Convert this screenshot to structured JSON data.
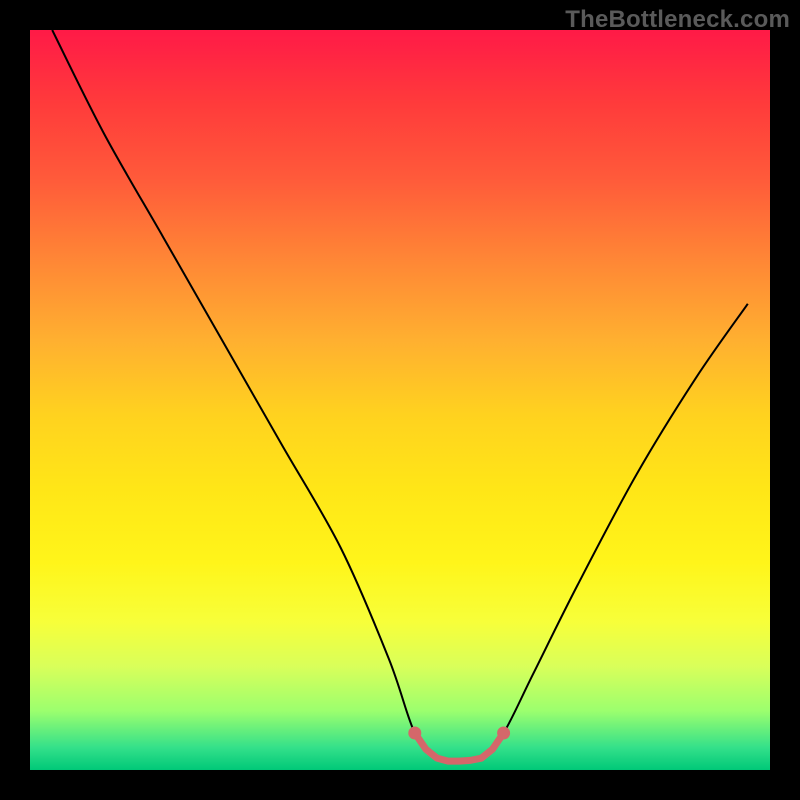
{
  "watermark": "TheBottleneck.com",
  "colors": {
    "frame": "#000000",
    "gradient_top": "#ff1a47",
    "gradient_bottom": "#00c878",
    "curve": "#000000",
    "marker_stroke": "#d4676a",
    "marker_fill": "#d4676a"
  },
  "chart_data": {
    "type": "line",
    "title": "",
    "xlabel": "",
    "ylabel": "",
    "xlim": [
      0,
      100
    ],
    "ylim": [
      0,
      100
    ],
    "series": [
      {
        "name": "curve",
        "x": [
          3,
          10,
          18,
          26,
          34,
          42,
          48.5,
          52,
          55,
          58,
          61,
          64,
          68,
          74,
          82,
          90,
          97
        ],
        "values": [
          100,
          86,
          72,
          58,
          44,
          30,
          15,
          5,
          1.5,
          1.2,
          1.5,
          5,
          13,
          25,
          40,
          53,
          63
        ]
      }
    ],
    "annotations": [
      {
        "name": "trough-segment",
        "kind": "polyline",
        "color": "#d4676a",
        "x": [
          52,
          53.5,
          55,
          56.5,
          58,
          59.5,
          61,
          62.5,
          64
        ],
        "y": [
          5,
          2.8,
          1.6,
          1.2,
          1.2,
          1.3,
          1.6,
          2.8,
          5
        ]
      }
    ]
  }
}
